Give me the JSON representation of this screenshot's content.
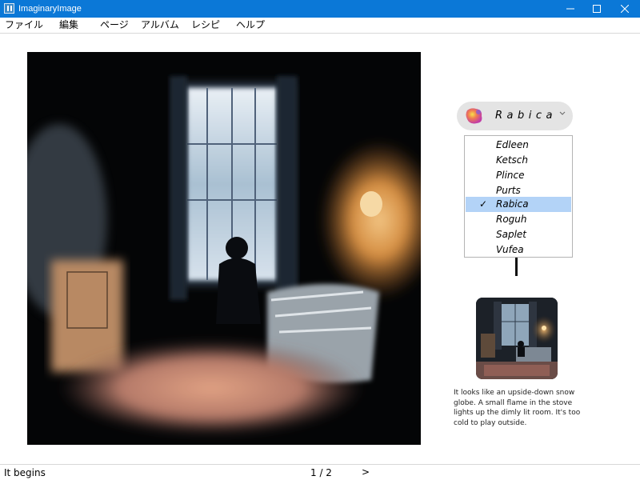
{
  "window": {
    "title": "ImaginaryImage"
  },
  "menu": {
    "items": [
      "ファイル",
      "編集",
      "ページ",
      "アルバム",
      "レシピ",
      "ヘルプ"
    ]
  },
  "character": {
    "selected": "Rabica",
    "options": [
      "Edleen",
      "Ketsch",
      "Plince",
      "Purts",
      "Rabica",
      "Roguh",
      "Saplet",
      "Vufea"
    ],
    "selected_index": 4,
    "check_mark": "✓"
  },
  "caption": {
    "text": "It looks like an upside-down snow globe. A small flame in the stove lights up the dimly lit room. It's too cold to play outside."
  },
  "status": {
    "text": "It begins",
    "page": "1 / 2",
    "next": ">"
  },
  "colors": {
    "titlebar": "#0b78d7",
    "selection": "#b3d3f7",
    "selector_bg": "#e4e4e4"
  },
  "icons": {
    "app": "app-icon",
    "minimize": "minimize-icon",
    "maximize": "maximize-icon",
    "close": "close-icon",
    "chevron": "chevron-down-icon"
  }
}
